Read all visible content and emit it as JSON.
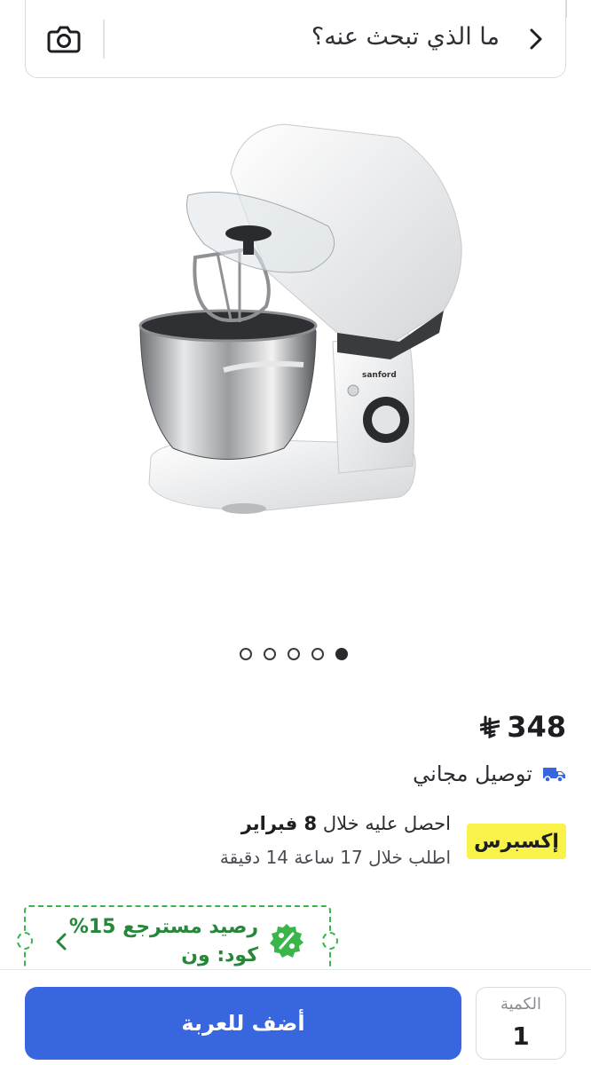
{
  "search": {
    "placeholder": "ما الذي تبحث عنه؟"
  },
  "product": {
    "image_alt": "stand mixer",
    "image_brand_mark": "sanford",
    "carousel": {
      "count": 5,
      "active_index": 4
    },
    "price": "348",
    "currency_icon": "saudi-riyal-symbol"
  },
  "delivery": {
    "free_label": "توصيل مجاني",
    "express_label": "إكسبرس",
    "get_it_prefix": "احصل عليه خلال",
    "get_it_date": "8 فبراير",
    "order_within": "اطلب خلال 17 ساعة 14 دقيقة"
  },
  "cashback": {
    "title": "رصيد مسترجع 15%",
    "code": "كود: ون"
  },
  "cart": {
    "quantity_label": "الكمية",
    "quantity_value": "1",
    "add_label": "أضف للعربة"
  },
  "colors": {
    "primary_blue": "#3866df",
    "express_yellow": "#f9f24a",
    "cashback_green": "#39b54a",
    "truck_blue": "#3866df"
  }
}
